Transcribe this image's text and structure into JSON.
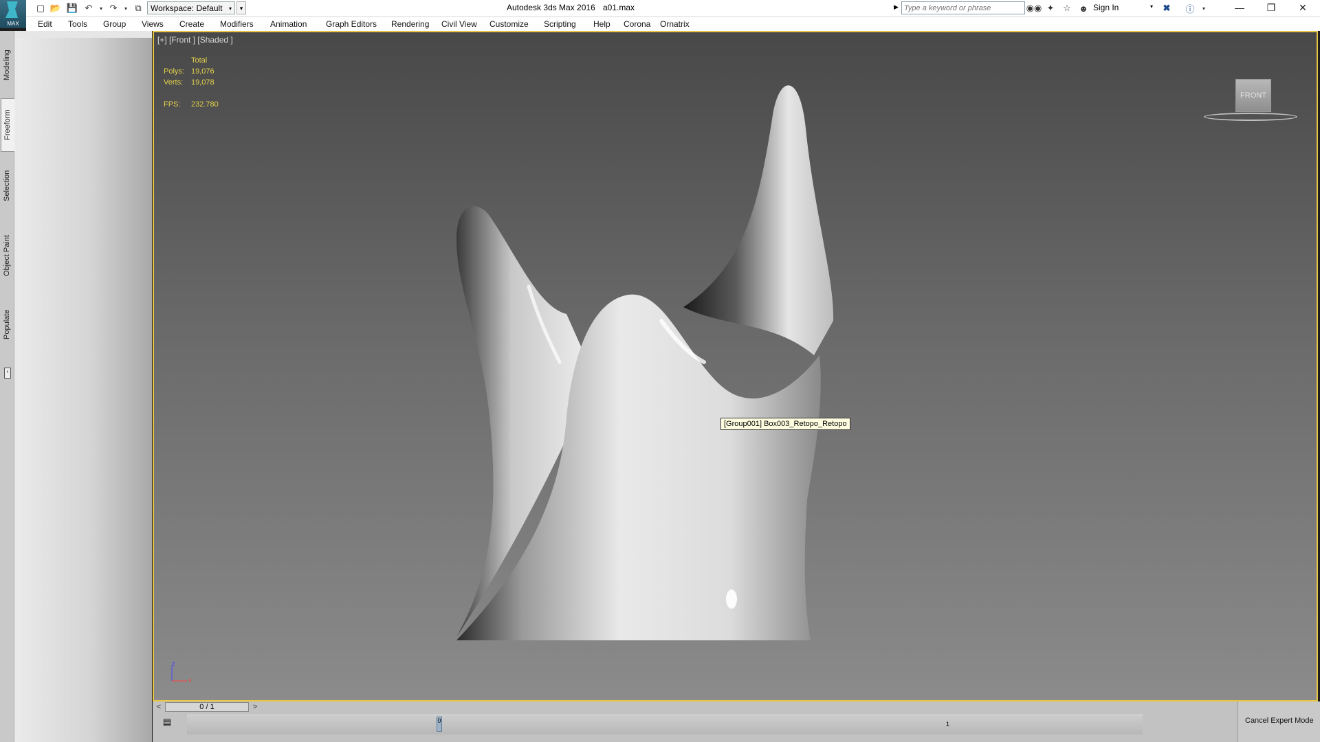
{
  "app": {
    "logo_text": "MAX",
    "title": "Autodesk 3ds Max 2016",
    "file": "a01.max",
    "workspace": "Workspace: Default"
  },
  "search": {
    "placeholder": "Type a keyword or phrase"
  },
  "account": {
    "sign_in": "Sign In"
  },
  "menu": [
    "Edit",
    "Tools",
    "Group",
    "Views",
    "Create",
    "Modifiers",
    "Animation",
    "Graph Editors",
    "Rendering",
    "Civil View",
    "Customize",
    "Scripting",
    "Help",
    "Corona",
    "Ornatrix"
  ],
  "ribbon_tabs": [
    "Modeling",
    "Freeform",
    "Selection",
    "Object Paint",
    "Populate"
  ],
  "viewport": {
    "label": "[+] [Front ] [Shaded ]",
    "stats": {
      "total_label": "Total",
      "polys_label": "Polys:",
      "polys": "19,076",
      "verts_label": "Verts:",
      "verts": "19,078",
      "fps_label": "FPS:",
      "fps": "232.780"
    },
    "viewcube_face": "FRONT",
    "tooltip": "[Group001] Box003_Retopo_Retopo",
    "axis": {
      "z": "z",
      "x": "x"
    }
  },
  "timeline": {
    "prev": "<",
    "next": ">",
    "frame": "0 / 1",
    "key_label": "0",
    "end_label": "1"
  },
  "status": {
    "cancel_expert": "Cancel Expert Mode"
  },
  "colors": {
    "viewport_border": "#e8c542",
    "stats_text": "#e4d24b"
  }
}
